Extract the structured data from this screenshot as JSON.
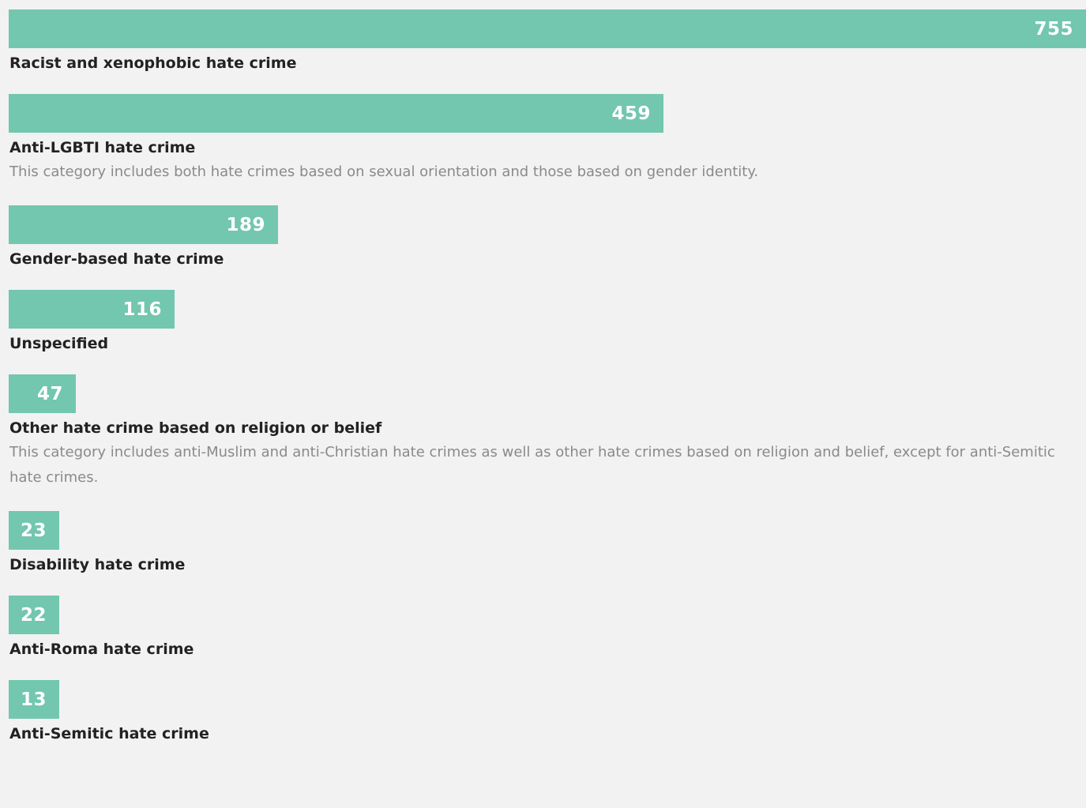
{
  "chart_data": {
    "type": "bar",
    "orientation": "horizontal",
    "categories": [
      "Racist and xenophobic hate crime",
      "Anti-LGBTI hate crime",
      "Gender-based hate crime",
      "Unspecified",
      "Other hate crime based on religion or belief",
      "Disability hate crime",
      "Anti-Roma hate crime",
      "Anti-Semitic hate crime"
    ],
    "values": [
      755,
      459,
      189,
      116,
      47,
      23,
      22,
      13
    ],
    "value_labels": [
      "755",
      "459",
      "189",
      "116",
      "47",
      "23",
      "22",
      "13"
    ],
    "notes": [
      "",
      "This category includes both hate crimes based on sexual orientation and those based on gender identity.",
      "",
      "",
      "This category includes anti-Muslim and anti-Christian hate crimes as well as other hate crimes based on religion and belief, except for anti-Semitic hate crimes.",
      "",
      "",
      ""
    ],
    "bar_color": "#72c7ae",
    "xlim": [
      0,
      755
    ],
    "grid": false,
    "legend": "none"
  }
}
